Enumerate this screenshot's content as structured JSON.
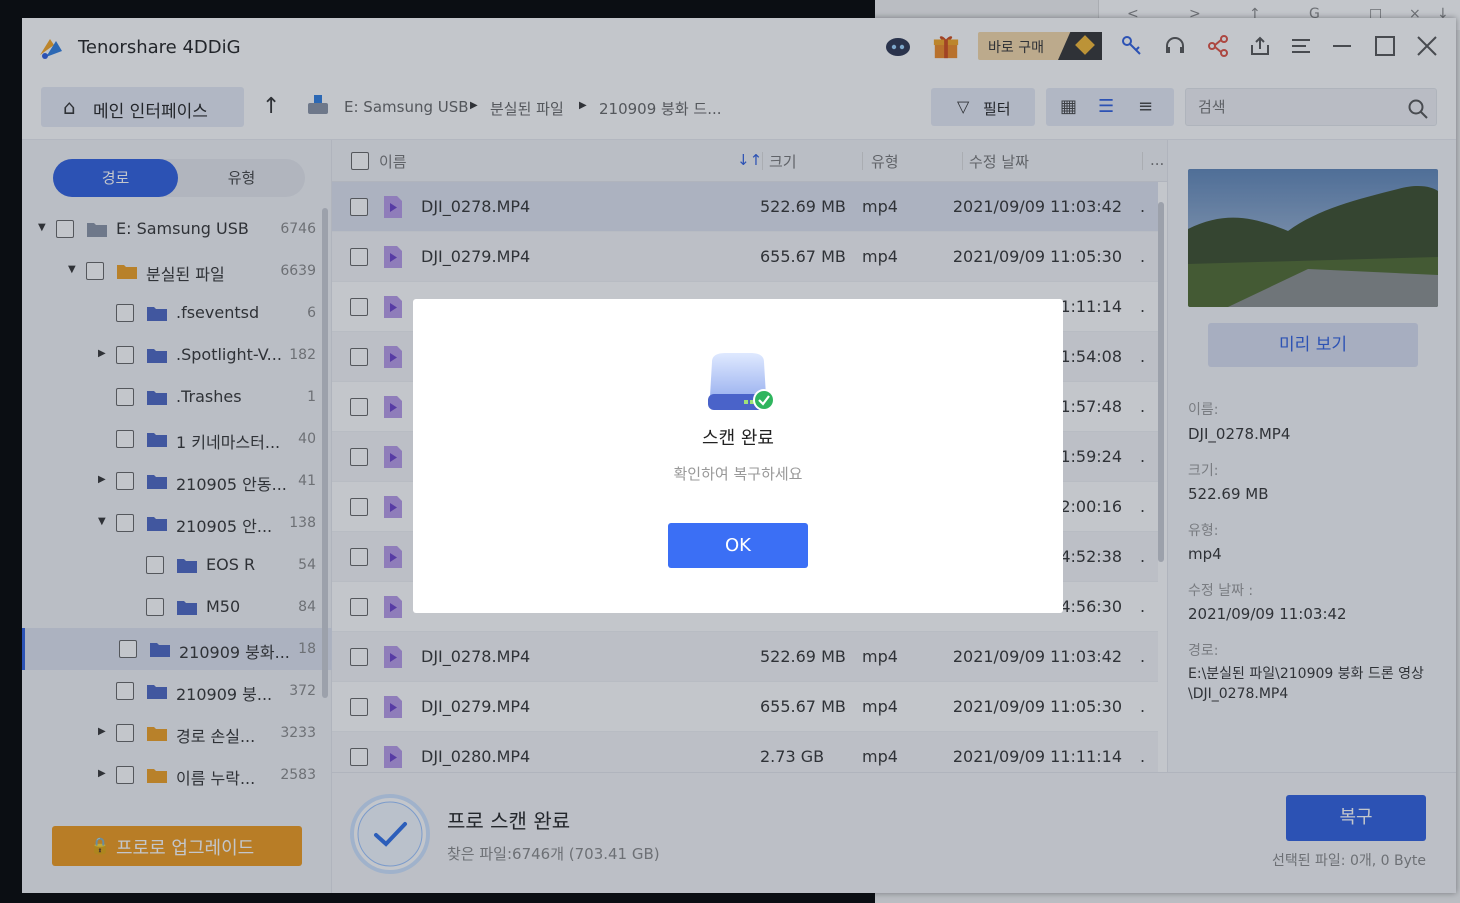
{
  "app": {
    "title": "Tenorshare 4DDiG",
    "buy_label": "바로 구매"
  },
  "nav": {
    "home_label": "메인 인터페이스",
    "breadcrumb": [
      "E: Samsung USB",
      "분실된 파일",
      "210909 붕화 드..."
    ],
    "filter_label": "필터",
    "search_placeholder": "검색"
  },
  "sidebar": {
    "tabs": [
      "경로",
      "유형"
    ],
    "tree": [
      {
        "name": "E: Samsung USB",
        "count": "6746",
        "icon": "usb-drive-icon",
        "expand": "expanded"
      },
      {
        "name": "분실된 파일",
        "count": "6639",
        "icon": "lost-files-folder-icon",
        "expand": "expanded"
      },
      {
        "name": ".fseventsd",
        "count": "6",
        "icon": "folder-icon",
        "expand": "none"
      },
      {
        "name": ".Spotlight-V...",
        "count": "182",
        "icon": "folder-icon",
        "expand": "collapsed"
      },
      {
        "name": ".Trashes",
        "count": "1",
        "icon": "folder-icon",
        "expand": "none"
      },
      {
        "name": "1 키네마스터...",
        "count": "40",
        "icon": "folder-icon",
        "expand": "none"
      },
      {
        "name": "210905 안동...",
        "count": "41",
        "icon": "folder-icon",
        "expand": "collapsed"
      },
      {
        "name": "210905 안...",
        "count": "138",
        "icon": "folder-icon",
        "expand": "expanded"
      },
      {
        "name": "EOS R",
        "count": "54",
        "icon": "folder-icon",
        "expand": "none"
      },
      {
        "name": "M50",
        "count": "84",
        "icon": "folder-icon",
        "expand": "none"
      },
      {
        "name": "210909 붕화...",
        "count": "18",
        "icon": "folder-icon",
        "expand": "none",
        "selected": true
      },
      {
        "name": "210909 붕...",
        "count": "372",
        "icon": "folder-icon",
        "expand": "none"
      },
      {
        "name": "경로 손실...",
        "count": "3233",
        "icon": "lost-path-folder-icon",
        "expand": "collapsed"
      },
      {
        "name": "이름 누락...",
        "count": "2583",
        "icon": "missing-name-folder-icon",
        "expand": "collapsed"
      }
    ],
    "upgrade_label": "프로로 업그레이드"
  },
  "filelist": {
    "headers": {
      "name": "이름",
      "size": "크기",
      "type": "유형",
      "modified": "수정 날짜",
      "more": "..."
    },
    "rows": [
      {
        "name": "DJI_0278.MP4",
        "size": "522.69 MB",
        "type": "mp4",
        "date": "2021/09/09 11:03:42",
        "more": ".",
        "selected": true
      },
      {
        "name": "DJI_0279.MP4",
        "size": "655.67 MB",
        "type": "mp4",
        "date": "2021/09/09 11:05:30",
        "more": "."
      },
      {
        "name": "",
        "size": "",
        "type": "",
        "date": "1:11:14",
        "more": "."
      },
      {
        "name": "",
        "size": "",
        "type": "",
        "date": "1:54:08",
        "more": "."
      },
      {
        "name": "",
        "size": "",
        "type": "",
        "date": "1:57:48",
        "more": "."
      },
      {
        "name": "",
        "size": "",
        "type": "",
        "date": "1:59:24",
        "more": "."
      },
      {
        "name": "",
        "size": "",
        "type": "",
        "date": "2:00:16",
        "more": "."
      },
      {
        "name": "",
        "size": "",
        "type": "",
        "date": "4:52:38",
        "more": "."
      },
      {
        "name": "",
        "size": "",
        "type": "",
        "date": "4:56:30",
        "more": "."
      },
      {
        "name": "DJI_0278.MP4",
        "size": "522.69 MB",
        "type": "mp4",
        "date": "2021/09/09 11:03:42",
        "more": "."
      },
      {
        "name": "DJI_0279.MP4",
        "size": "655.67 MB",
        "type": "mp4",
        "date": "2021/09/09 11:05:30",
        "more": "."
      },
      {
        "name": "DJI_0280.MP4",
        "size": "2.73 GB",
        "type": "mp4",
        "date": "2021/09/09 11:11:14",
        "more": "."
      }
    ]
  },
  "details": {
    "preview_label": "미리 보기",
    "name_label": "이름:",
    "name": "DJI_0278.MP4",
    "size_label": "크기:",
    "size": "522.69 MB",
    "type_label": "유형:",
    "type": "mp4",
    "date_label": "수정 날짜 :",
    "date": "2021/09/09 11:03:42",
    "path_label": "경로:",
    "path": "E:\\분실된 파일\\210909 붕화 드론 영상\\DJI_0278.MP4"
  },
  "bottom": {
    "title": "프로 스캔 완료",
    "found": "찾은 파일:6746개 (703.41 GB)",
    "recover_label": "복구",
    "selected": "선택된 파일: 0개, 0 Byte"
  },
  "modal": {
    "title": "스캔 완료",
    "subtitle": "확인하여 복구하세요",
    "ok_label": "OK"
  },
  "bg": {
    "strip_glyphs": [
      "<",
      ">",
      "↑",
      "G",
      "□",
      "×",
      "↓"
    ]
  },
  "colors": {
    "accent": "#2f5fe0",
    "upgrade": "#f09a1b",
    "video": "#8c5cd9"
  }
}
